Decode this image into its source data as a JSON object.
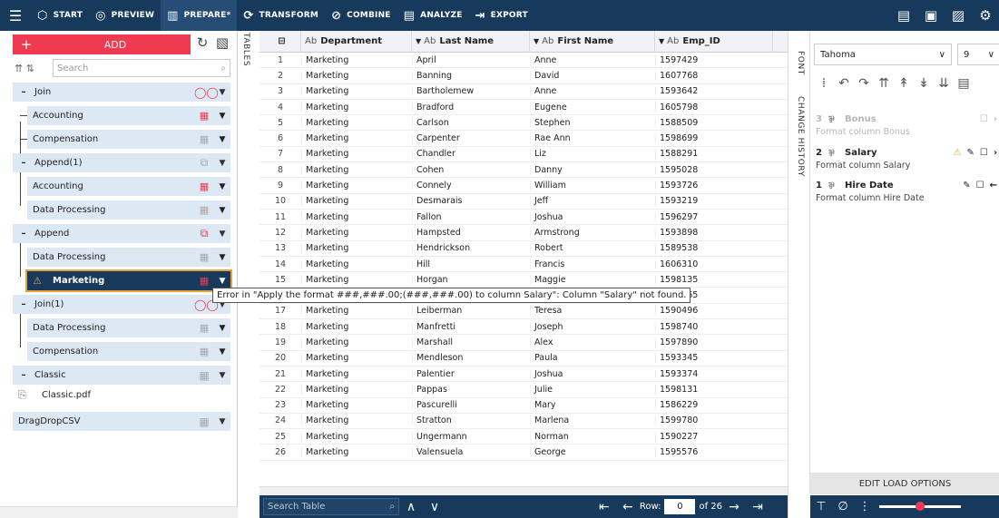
{
  "topbar": {
    "menu_icon": "hamburger-icon",
    "items": [
      {
        "label": "START",
        "icon": "cube-icon"
      },
      {
        "label": "PREVIEW",
        "icon": "eye-icon"
      },
      {
        "label": "PREPARE*",
        "icon": "columns-icon",
        "active": true
      },
      {
        "label": "TRANSFORM",
        "icon": "transform-icon"
      },
      {
        "label": "COMBINE",
        "icon": "combine-icon"
      },
      {
        "label": "ANALYZE",
        "icon": "analyze-icon"
      },
      {
        "label": "EXPORT",
        "icon": "export-icon"
      }
    ]
  },
  "left": {
    "add_label": "ADD",
    "tables_label": "TABLES",
    "search_placeholder": "Search",
    "tree": [
      {
        "name": "Join",
        "type": "join"
      },
      {
        "name": "Accounting"
      },
      {
        "name": "Compensation"
      },
      {
        "name": "Append(1)",
        "type": "append"
      },
      {
        "name": "Accounting"
      },
      {
        "name": "Data Processing"
      },
      {
        "name": "Append",
        "type": "append"
      },
      {
        "name": "Data Processing"
      },
      {
        "name": "Marketing",
        "selected": true,
        "warning": true
      },
      {
        "name": "Join(1)",
        "type": "join"
      },
      {
        "name": "Data Processing"
      },
      {
        "name": "Compensation"
      },
      {
        "name": "Classic"
      },
      {
        "name": "Classic.pdf"
      },
      {
        "name": "DragDropCSV"
      }
    ],
    "error_tooltip": "Error in \"Apply the format ###,###.00;(###,###.00) to column Salary\": Column \"Salary\" not found."
  },
  "table": {
    "columns": [
      {
        "type": "Ab",
        "name": "Department"
      },
      {
        "type": "Ab",
        "name": "Last Name"
      },
      {
        "type": "Ab",
        "name": "First Name"
      },
      {
        "type": "Ab",
        "name": "Emp_ID"
      }
    ],
    "rows": [
      [
        "1",
        "Marketing",
        "April",
        "Anne",
        "1597429"
      ],
      [
        "2",
        "Marketing",
        "Banning",
        "David",
        "1607768"
      ],
      [
        "3",
        "Marketing",
        "Bartholemew",
        "Anne",
        "1593642"
      ],
      [
        "4",
        "Marketing",
        "Bradford",
        "Eugene",
        "1605798"
      ],
      [
        "5",
        "Marketing",
        "Carlson",
        "Stephen",
        "1588509"
      ],
      [
        "6",
        "Marketing",
        "Carpenter",
        "Rae Ann",
        "1598699"
      ],
      [
        "7",
        "Marketing",
        "Chandler",
        "Liz",
        "1588291"
      ],
      [
        "8",
        "Marketing",
        "Cohen",
        "Danny",
        "1595028"
      ],
      [
        "9",
        "Marketing",
        "Connely",
        "William",
        "1593726"
      ],
      [
        "10",
        "Marketing",
        "Desmarais",
        "Jeff",
        "1593219"
      ],
      [
        "11",
        "Marketing",
        "Fallon",
        "Joshua",
        "1596297"
      ],
      [
        "12",
        "Marketing",
        "Hampsted",
        "Armstrong",
        "1593898"
      ],
      [
        "13",
        "Marketing",
        "Hendrickson",
        "Robert",
        "1589538"
      ],
      [
        "14",
        "Marketing",
        "Hill",
        "Francis",
        "1606310"
      ],
      [
        "15",
        "Marketing",
        "Horgan",
        "Maggie",
        "1598135"
      ],
      [
        "16",
        "Marketing",
        "",
        "",
        "1589165"
      ],
      [
        "17",
        "Marketing",
        "Leiberman",
        "Teresa",
        "1590496"
      ],
      [
        "18",
        "Marketing",
        "Manfretti",
        "Joseph",
        "1598740"
      ],
      [
        "19",
        "Marketing",
        "Marshall",
        "Alex",
        "1597890"
      ],
      [
        "20",
        "Marketing",
        "Mendleson",
        "Paula",
        "1593345"
      ],
      [
        "21",
        "Marketing",
        "Palentier",
        "Joshua",
        "1593374"
      ],
      [
        "22",
        "Marketing",
        "Pappas",
        "Julie",
        "1598131"
      ],
      [
        "23",
        "Marketing",
        "Pascurelli",
        "Mary",
        "1586229"
      ],
      [
        "24",
        "Marketing",
        "Stratton",
        "Marlena",
        "1599780"
      ],
      [
        "25",
        "Marketing",
        "Ungermann",
        "Norman",
        "1590227"
      ],
      [
        "26",
        "Marketing",
        "Valensuela",
        "George",
        "1595576"
      ]
    ],
    "search_placeholder": "Search Table",
    "row_label": "Row:",
    "row_value": "0",
    "of_label": "of 26"
  },
  "right": {
    "font_tab": "FONT",
    "history_tab": "CHANGE HISTORY",
    "font_name": "Tahoma",
    "font_size": "9",
    "history": [
      {
        "num": "3",
        "name": "Bonus",
        "desc": "Format column Bonus",
        "faded": true
      },
      {
        "num": "2",
        "name": "Salary",
        "desc": "Format column Salary",
        "warning": true
      },
      {
        "num": "1",
        "name": "Hire Date",
        "desc": "Format column Hire Date"
      }
    ],
    "edit_load_options": "EDIT LOAD OPTIONS"
  }
}
